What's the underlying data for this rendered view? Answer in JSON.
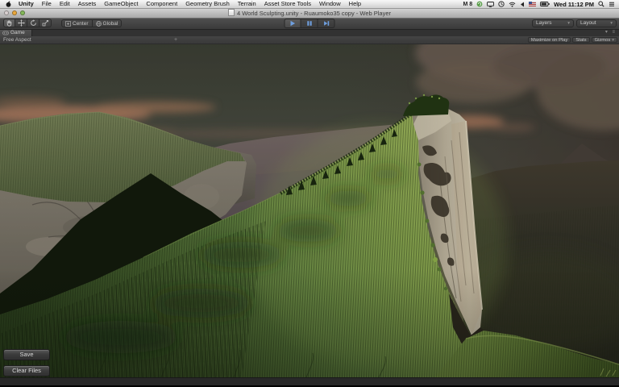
{
  "menubar": {
    "items": [
      "Unity",
      "File",
      "Edit",
      "Assets",
      "GameObject",
      "Component",
      "Geometry Brush",
      "Terrain",
      "Asset Store Tools",
      "Window",
      "Help"
    ],
    "status_badge": "M 8",
    "clock": "Wed 11:12 PM"
  },
  "titlebar": {
    "title": "4 World Sculpting.unity - Ruaumoko35 copy - Web Player"
  },
  "toolbar": {
    "pivot_label": "Center",
    "space_label": "Global",
    "layers_label": "Layers",
    "layout_label": "Layout",
    "dropdown_arrow": "▾"
  },
  "gameview": {
    "tab_label": "Game",
    "aspect_label": "Free Aspect",
    "plus_label": "+",
    "maximize_label": "Maximize on Play",
    "stats_label": "Stats",
    "gizmos_label": "Gizmos",
    "gizmos_arrow": "▾",
    "corner_icons": "▾ ≡"
  },
  "game_ui": {
    "save_label": "Save",
    "clear_label": "Clear Files"
  },
  "scene": {
    "description": "Sunset-lit 3D terrain: grassy mountain ridge ending in a sheer pale rock cliff, rocky mountain at left, hazy pink clouds, dark valley at right",
    "colors": {
      "sky_top": "#3e4136",
      "sky_haze": "#6b6152",
      "cloud_pink": "#b28064",
      "cloud_gray": "#6e6055",
      "grass_lit": "#a9c263",
      "grass_dark": "#2f4520",
      "cliff_lit": "#d8cfb9",
      "cliff_crevice": "#3b3428",
      "valley_dark": "#2b2b21",
      "play_icon_blue": "#6f9fdf"
    }
  }
}
